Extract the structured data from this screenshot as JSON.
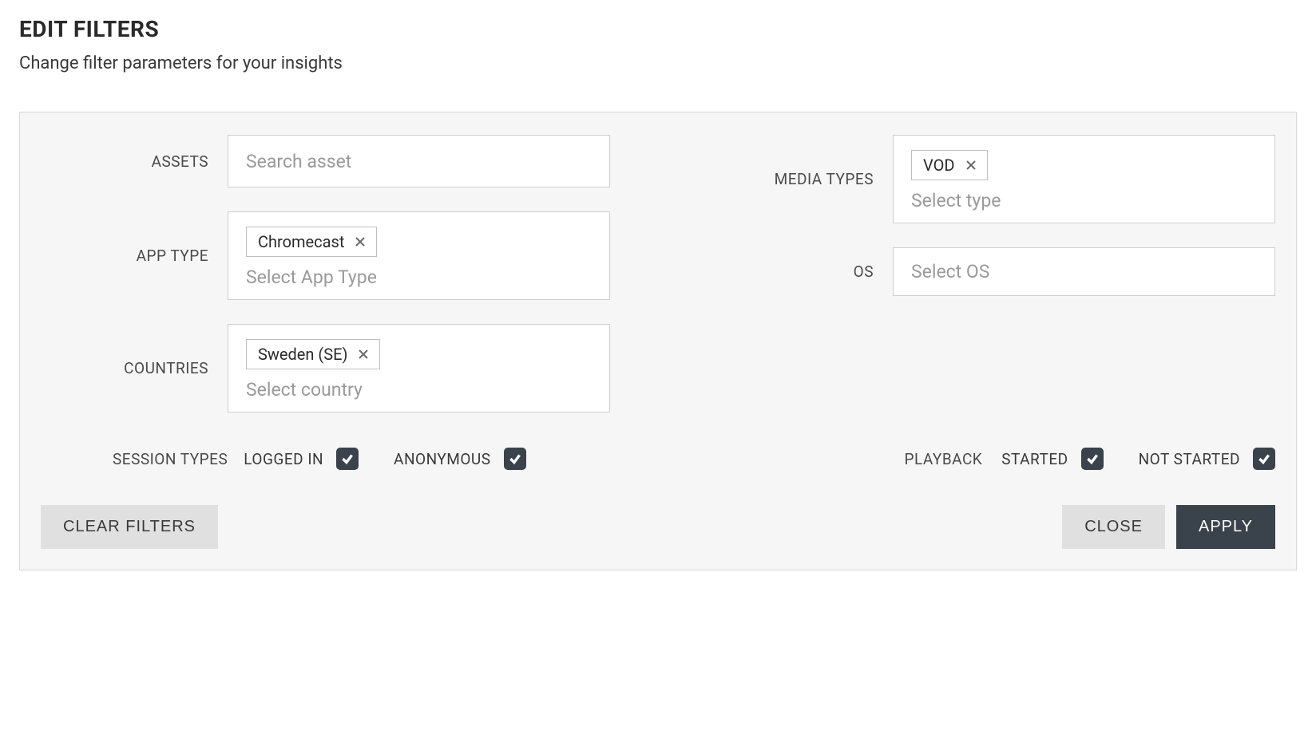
{
  "header": {
    "title": "EDIT FILTERS",
    "subtitle": "Change filter parameters for your insights"
  },
  "filters": {
    "assets": {
      "label": "ASSETS",
      "placeholder": "Search asset",
      "value": ""
    },
    "appType": {
      "label": "APP TYPE",
      "placeholder": "Select App Type",
      "tags": [
        {
          "label": "Chromecast"
        }
      ]
    },
    "countries": {
      "label": "COUNTRIES",
      "placeholder": "Select country",
      "tags": [
        {
          "label": "Sweden (SE)"
        }
      ]
    },
    "mediaTypes": {
      "label": "MEDIA TYPES",
      "placeholder": "Select type",
      "tags": [
        {
          "label": "VOD"
        }
      ]
    },
    "os": {
      "label": "OS",
      "placeholder": "Select OS",
      "tags": []
    }
  },
  "sessionTypes": {
    "label": "SESSION TYPES",
    "options": [
      {
        "label": "LOGGED IN",
        "checked": true
      },
      {
        "label": "ANONYMOUS",
        "checked": true
      }
    ]
  },
  "playback": {
    "label": "PLAYBACK",
    "options": [
      {
        "label": "STARTED",
        "checked": true
      },
      {
        "label": "NOT STARTED",
        "checked": true
      }
    ]
  },
  "actions": {
    "clear": "CLEAR FILTERS",
    "close": "CLOSE",
    "apply": "APPLY"
  }
}
